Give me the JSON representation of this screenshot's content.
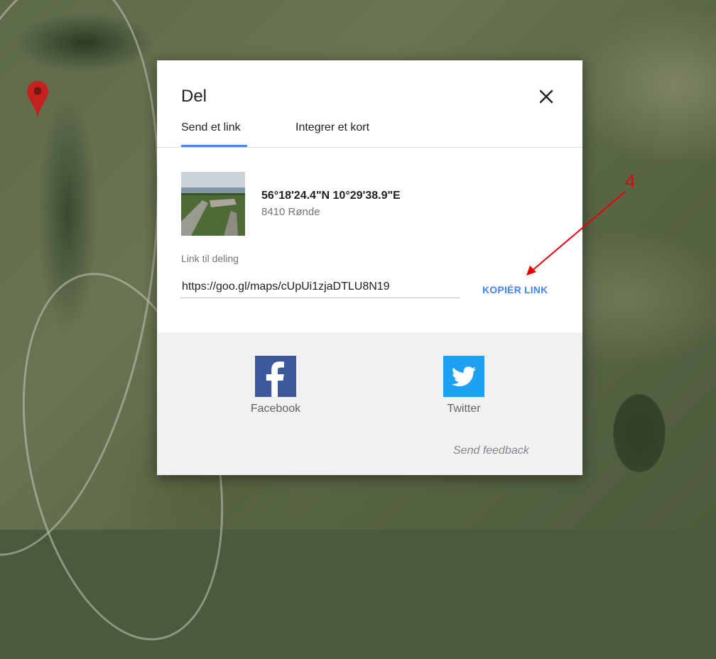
{
  "dialog": {
    "title": "Del",
    "tabs": [
      {
        "label": "Send et link"
      },
      {
        "label": "Integrer et kort"
      }
    ]
  },
  "place": {
    "coords": "56°18'24.4\"N 10°29'38.9\"E",
    "address": "8410 Rønde"
  },
  "link": {
    "label": "Link til deling",
    "value": "https://goo.gl/maps/cUpUi1zjaDTLU8N19",
    "copy_label": "KOPIÉR LINK"
  },
  "share": {
    "facebook_label": "Facebook",
    "twitter_label": "Twitter",
    "feedback_label": "Send feedback"
  },
  "annotation": {
    "number": "4",
    "color": "#e8000a"
  },
  "colors": {
    "accent": "#4285f4",
    "facebook": "#3b5998",
    "twitter": "#1da1f2",
    "pin": "#c5221f"
  }
}
